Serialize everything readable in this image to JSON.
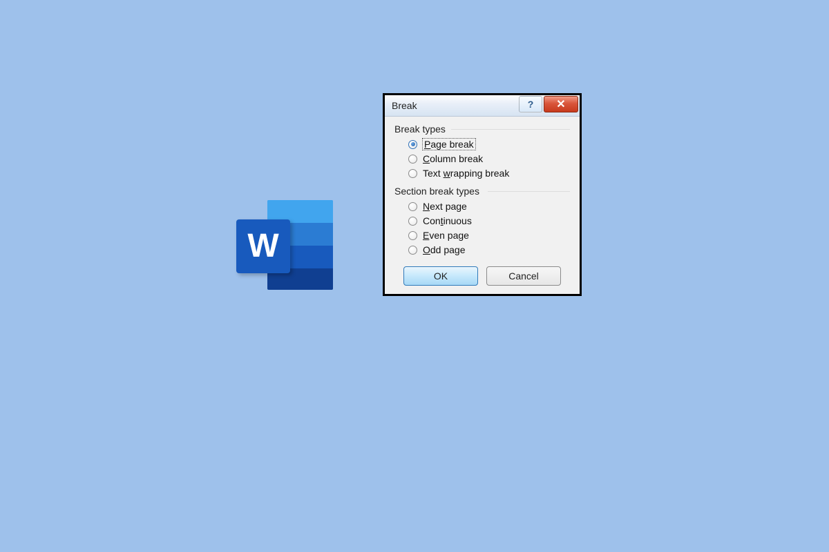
{
  "word_icon": {
    "letter": "W"
  },
  "dialog": {
    "title": "Break",
    "help_glyph": "?",
    "close_glyph": "✕",
    "group1_label": "Break types",
    "group2_label": "Section break types",
    "options1": [
      {
        "pre": "",
        "accel": "P",
        "post": "age break",
        "selected": true
      },
      {
        "pre": "",
        "accel": "C",
        "post": "olumn break",
        "selected": false
      },
      {
        "pre": "Text ",
        "accel": "w",
        "post": "rapping break",
        "selected": false
      }
    ],
    "options2": [
      {
        "pre": "",
        "accel": "N",
        "post": "ext page",
        "selected": false
      },
      {
        "pre": "Con",
        "accel": "t",
        "post": "inuous",
        "selected": false
      },
      {
        "pre": "",
        "accel": "E",
        "post": "ven page",
        "selected": false
      },
      {
        "pre": "",
        "accel": "O",
        "post": "dd page",
        "selected": false
      }
    ],
    "ok_label": "OK",
    "cancel_label": "Cancel"
  }
}
